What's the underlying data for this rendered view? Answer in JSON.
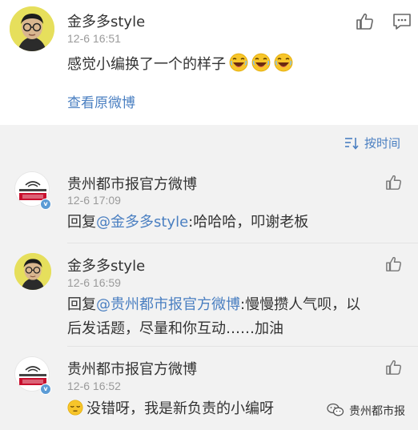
{
  "main_comment": {
    "username": "金多多style",
    "timestamp": "12-6 16:51",
    "text": "感觉小编换了一个的样子",
    "emoji_count": 3,
    "view_original_label": "查看原微博"
  },
  "sort": {
    "label": "按时间"
  },
  "replies": [
    {
      "username": "贵州都市报官方微博",
      "timestamp": "12-6 17:09",
      "reply_prefix": "回复",
      "mention": "@金多多style",
      "text": ":哈哈哈，叩谢老板",
      "verified": true,
      "avatar": "news-logo"
    },
    {
      "username": "金多多style",
      "timestamp": "12-6 16:59",
      "reply_prefix": "回复",
      "mention": "@贵州都市报官方微博",
      "text_line1": ":慢慢攒人气呗，以",
      "text_line2": "后发话题，尽量和你互动……加油",
      "avatar": "person"
    },
    {
      "username": "贵州都市报官方微博",
      "timestamp": "12-6 16:52",
      "text": "没错呀，我是新负责的小编呀",
      "verified": true,
      "avatar": "news-logo",
      "emoji": "sleepy-face"
    }
  ],
  "watermark": {
    "label": "贵州都市报"
  },
  "colors": {
    "link": "#4a7fc1",
    "background": "#f2f2f2",
    "card": "#ffffff"
  },
  "icons": [
    "like-icon",
    "comment-icon",
    "sort-icon",
    "verified-badge-icon",
    "wechat-icon"
  ]
}
